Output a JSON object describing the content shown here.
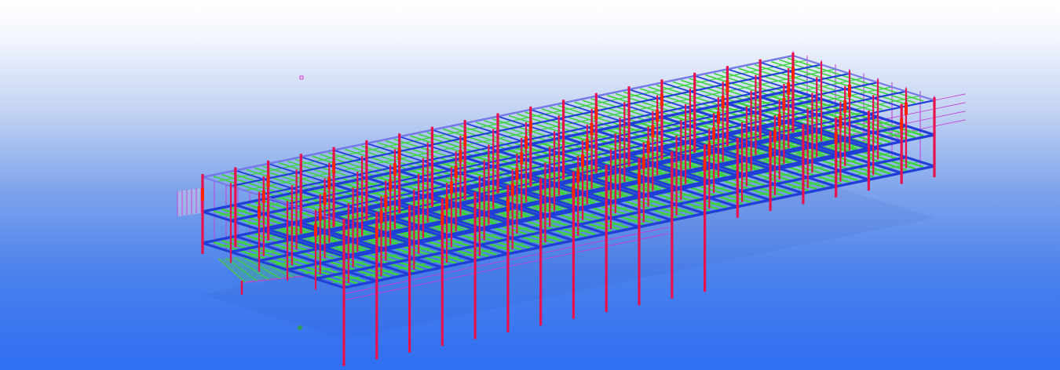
{
  "viewport": {
    "background_top": "#ffffff",
    "background_bottom": "#2f6ef2"
  },
  "model": {
    "colors": {
      "column": "#e8114b",
      "primary_beam": "#1f3fd6",
      "secondary_beam": "#3bd43b",
      "bracing": "#c43ad8",
      "connection": "#ff2200"
    },
    "layers": [
      "columns",
      "primary-beams",
      "secondary-beams",
      "bracing",
      "connections"
    ]
  },
  "markers": [
    {
      "name": "pink-marker-icon",
      "color": "#e040c8"
    },
    {
      "name": "green-marker-icon",
      "color": "#2e9e55"
    }
  ]
}
